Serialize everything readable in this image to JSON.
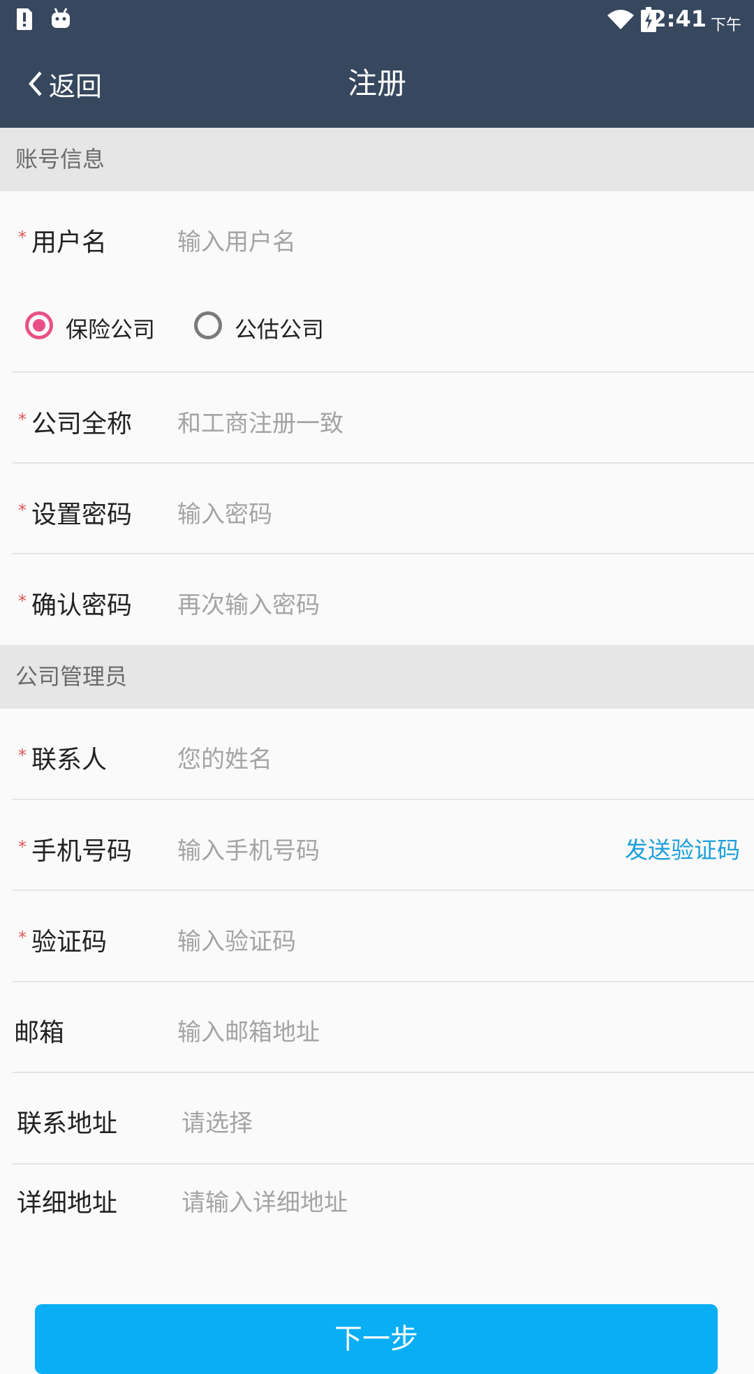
{
  "status_bar": {
    "time": "2:41",
    "ampm": "下午"
  },
  "nav": {
    "back_label": "返回",
    "title": "注册"
  },
  "sections": {
    "account": "账号信息",
    "admin": "公司管理员"
  },
  "fields": {
    "username": {
      "label": "用户名",
      "placeholder": "输入用户名",
      "required": "*"
    },
    "company_type": {
      "options": [
        "保险公司",
        "公估公司"
      ],
      "selected": "保险公司"
    },
    "company_name": {
      "label": "公司全称",
      "placeholder": "和工商注册一致",
      "required": "*"
    },
    "password": {
      "label": "设置密码",
      "placeholder": "输入密码",
      "required": "*"
    },
    "confirm_password": {
      "label": "确认密码",
      "placeholder": "再次输入密码",
      "required": "*"
    },
    "contact": {
      "label": "联系人",
      "placeholder": "您的姓名",
      "required": "*"
    },
    "phone": {
      "label": "手机号码",
      "placeholder": "输入手机号码",
      "required": "*",
      "send_code": "发送验证码"
    },
    "code": {
      "label": "验证码",
      "placeholder": "输入验证码",
      "required": "*"
    },
    "email": {
      "label": "邮箱",
      "placeholder": "输入邮箱地址"
    },
    "address": {
      "label": "联系地址",
      "placeholder": "请选择"
    },
    "address_detail": {
      "label": "详细地址",
      "placeholder": "请输入详细地址"
    }
  },
  "next_button": "下一步",
  "colors": {
    "header": "#36475E",
    "accent_radio": "#E94F86",
    "link": "#1E9FDB",
    "button": "#0AAEF5"
  }
}
